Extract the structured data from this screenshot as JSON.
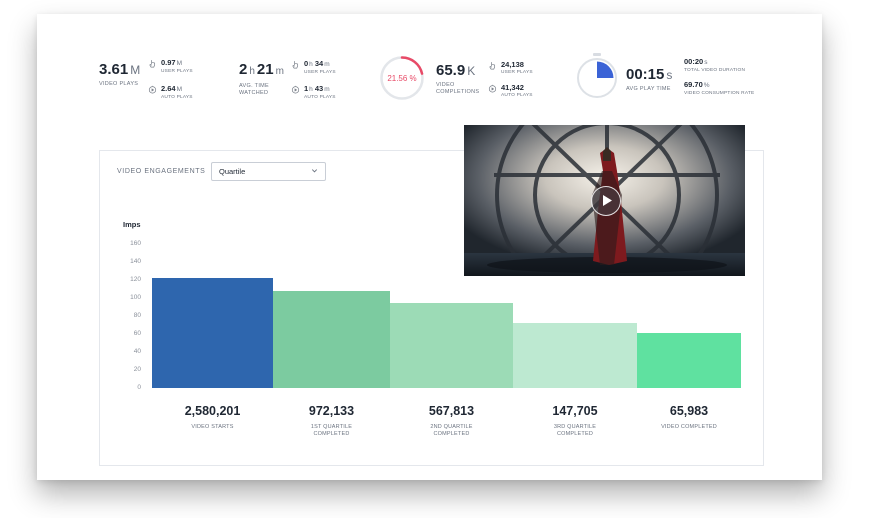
{
  "kpis": {
    "plays": {
      "value": "3.61",
      "unit": "M",
      "label": "VIDEO PLAYS",
      "user": {
        "value": "0.97",
        "unit": "M",
        "label": "USER PLAYS"
      },
      "auto": {
        "value": "2.64",
        "unit": "M",
        "label": "AUTO PLAYS"
      }
    },
    "time": {
      "h": "2",
      "h_unit": "h",
      "m": "21",
      "m_unit": "m",
      "label1": "AVG. TIME",
      "label2": "WATCHED",
      "user": {
        "h": "0",
        "h_unit": "h",
        "m": "34",
        "m_unit": "m",
        "label": "USER PLAYS"
      },
      "auto": {
        "h": "1",
        "h_unit": "h",
        "m": "43",
        "m_unit": "m",
        "label": "AUTO PLAYS"
      }
    },
    "completion_rate": {
      "value": "21.56 %",
      "fraction": 0.2156,
      "color": "#e84a67"
    },
    "completions": {
      "value": "65.9",
      "unit": "K",
      "label1": "VIDEO",
      "label2": "COMPLETIONS",
      "user": {
        "value": "24,138",
        "label": "USER PLAYS"
      },
      "auto": {
        "value": "41,342",
        "label": "AUTO PLAYS"
      }
    },
    "play_time": {
      "value": "00:15",
      "unit": "s",
      "label": "AVG PLAY TIME",
      "fraction": 0.25,
      "color": "#3b63d6",
      "total": {
        "value": "00:20",
        "unit": "s",
        "label": "TOTAL VIDEO DURATION"
      },
      "consumption": {
        "value": "69.70",
        "unit": "%",
        "label": "VIDEO CONSUMPTION RATE"
      }
    }
  },
  "engagement": {
    "title": "VIDEO ENGAGEMENTS",
    "dropdown": {
      "selected": "Quartile",
      "icon": "chevron-down-icon"
    }
  },
  "video": {
    "play_icon": "play-icon"
  },
  "chart_data": {
    "type": "bar",
    "ylabel": "Imps",
    "ylim": [
      0,
      160
    ],
    "yticks": [
      "160",
      "140",
      "120",
      "100",
      "80",
      "60",
      "40",
      "20",
      "0"
    ],
    "categories": [
      [
        "VIDEO STARTS"
      ],
      [
        "1ST QUARTILE",
        "COMPLETED"
      ],
      [
        "2ND QUARTILE",
        "COMPLETED"
      ],
      [
        "3RD QUARTILE",
        "COMPLETED"
      ],
      [
        "VIDEO COMPLETED"
      ]
    ],
    "values": [
      122,
      108,
      94,
      72,
      61
    ],
    "value_labels": [
      "2,580,201",
      "972,133",
      "567,813",
      "147,705",
      "65,983"
    ],
    "colors": [
      "#2e66ae",
      "#7ccba0",
      "#9cdbb6",
      "#bde9d1",
      "#5fe1a0"
    ]
  }
}
